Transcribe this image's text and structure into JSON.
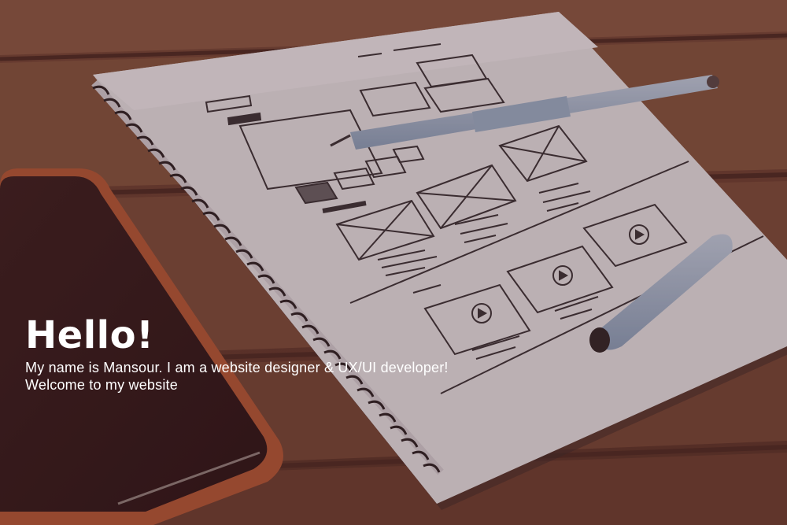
{
  "hero": {
    "title": "Hello!",
    "line1": "My name is Mansour. I am a website designer & UX/UI developer!",
    "line2": "Welcome to my website",
    "background": "photo of a spiral notebook with wireframe sketches, a pen and a smartphone on a wooden table",
    "overlay_color": "#3c191e"
  },
  "colors": {
    "text": "#ffffff",
    "wood": "#8a5a45",
    "paper": "#eceaee",
    "pen": "#a9bfd7",
    "phone_case": "#c2663f"
  }
}
